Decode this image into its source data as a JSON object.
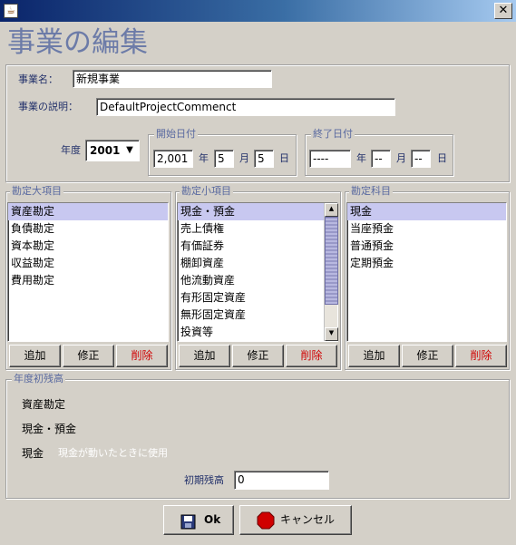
{
  "window": {
    "app_icon_glyph": "☕",
    "close_glyph": "✕"
  },
  "heading": "事業の編集",
  "top": {
    "name_label": "事業名：",
    "name_value": "新規事業",
    "desc_label": "事業の説明：",
    "desc_value": "DefaultProjectCommenct",
    "year_label": "年度",
    "year_value": "2001",
    "arrow_glyph": "▼"
  },
  "start_date": {
    "legend": "開始日付",
    "year": "2,001",
    "year_unit": "年",
    "month": "5",
    "month_unit": "月",
    "day": "5",
    "day_unit": "日"
  },
  "end_date": {
    "legend": "終了日付",
    "year": "----",
    "year_unit": "年",
    "month": "--",
    "month_unit": "月",
    "day": "--",
    "day_unit": "日"
  },
  "major_items": {
    "legend": "勘定大項目",
    "items": [
      "資産勘定",
      "負債勘定",
      "資本勘定",
      "収益勘定",
      "費用勘定"
    ],
    "selected": 0,
    "add": "追加",
    "edit": "修正",
    "delete": "削除"
  },
  "minor_items": {
    "legend": "勘定小項目",
    "items": [
      "現金・預金",
      "売上債権",
      "有価証券",
      "棚卸資産",
      "他流動資産",
      "有形固定資産",
      "無形固定資産",
      "投資等"
    ],
    "selected": 0,
    "add": "追加",
    "edit": "修正",
    "delete": "削除",
    "scroll_up_glyph": "▲",
    "scroll_down_glyph": "▼"
  },
  "accounts": {
    "legend": "勘定科目",
    "items": [
      "現金",
      "当座預金",
      "普通預金",
      "定期預金"
    ],
    "selected": 0,
    "add": "追加",
    "edit": "修正",
    "delete": "削除"
  },
  "opening_balance": {
    "legend": "年度初残高",
    "major": "資産勘定",
    "minor": "現金・預金",
    "account": "現金",
    "account_note": "現金が動いたときに使用",
    "balance_label": "初期残高",
    "balance_value": "0"
  },
  "footer": {
    "ok": "Ok",
    "cancel": "キャンセル"
  },
  "colors": {
    "accent": "#6c7ba8",
    "selection": "#c8c8f0",
    "delete_text": "#d00000",
    "cancel_icon": "#d00000"
  }
}
